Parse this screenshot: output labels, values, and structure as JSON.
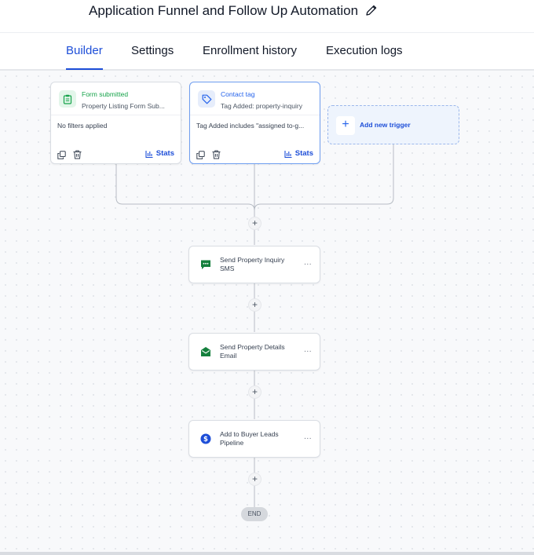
{
  "header": {
    "title": "Application Funnel and Follow Up Automation",
    "edit_icon": "pencil-icon"
  },
  "tabs": [
    {
      "label": "Builder",
      "active": true
    },
    {
      "label": "Settings",
      "active": false
    },
    {
      "label": "Enrollment history",
      "active": false
    },
    {
      "label": "Execution logs",
      "active": false
    }
  ],
  "triggers": [
    {
      "title": "Form submitted",
      "subtitle": "Property Listing Form Sub...",
      "filter": "No filters applied",
      "icon": "form-icon",
      "color": "#16a34a",
      "stats_label": "Stats"
    },
    {
      "title": "Contact tag",
      "subtitle": "Tag Added: property-inquiry",
      "filter": "Tag Added includes \"assigned to-g...",
      "icon": "tag-icon",
      "color": "#2563eb",
      "stats_label": "Stats"
    }
  ],
  "add_trigger": {
    "label": "Add new trigger",
    "icon": "plus-icon"
  },
  "actions": [
    {
      "label": "Send Property Inquiry SMS",
      "icon": "sms-icon",
      "color": "#15803d"
    },
    {
      "label": "Send Property Details Email",
      "icon": "email-icon",
      "color": "#15803d"
    },
    {
      "label": "Add to Buyer Leads Pipeline",
      "icon": "pipeline-dollar-icon",
      "color": "#1d4ed8"
    }
  ],
  "add_step_symbol": "+",
  "more_symbol": "...",
  "end_label": "END"
}
